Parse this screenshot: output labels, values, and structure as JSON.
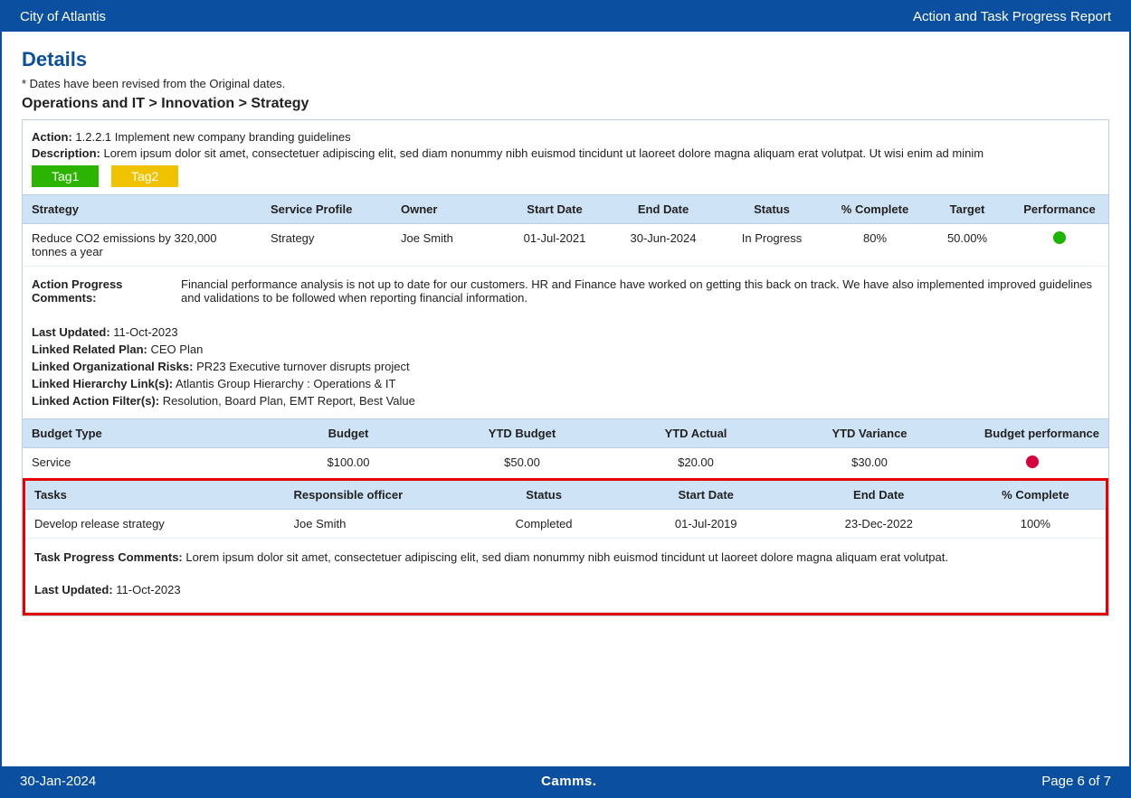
{
  "header": {
    "left": "City of Atlantis",
    "right": "Action and Task Progress Report"
  },
  "footer": {
    "date": "30-Jan-2024",
    "brand": "Camms.",
    "page": "Page 6 of 7"
  },
  "section_title": "Details",
  "date_note": "* Dates have been revised from the Original dates.",
  "breadcrumb": "Operations and IT > Innovation > Strategy",
  "action": {
    "action_label": "Action:",
    "action_value": "1.2.2.1 Implement new company branding guidelines",
    "description_label": "Description:",
    "description_value": "Lorem ipsum dolor sit amet, consectetuer adipiscing elit, sed diam nonummy nibh euismod tincidunt ut laoreet dolore magna aliquam erat volutpat. Ut wisi enim ad minim",
    "tags": [
      "Tag1",
      "Tag2"
    ]
  },
  "strategy_table": {
    "headers": [
      "Strategy",
      "Service Profile",
      "Owner",
      "Start Date",
      "End Date",
      "Status",
      "% Complete",
      "Target",
      "Performance"
    ],
    "row": {
      "strategy": "Reduce CO2 emissions by 320,000 tonnes a year",
      "service_profile": "Strategy",
      "owner": "Joe Smith",
      "start_date": "01-Jul-2021",
      "end_date": "30-Jun-2024",
      "status": "In Progress",
      "complete": "80%",
      "target": "50.00%",
      "perf_color": "green"
    }
  },
  "meta": {
    "apc_label": "Action Progress Comments:",
    "apc_value": "Financial performance analysis is not up to date for our customers. HR and Finance have worked on getting this back on track. We have also implemented improved guidelines and validations to be followed when reporting financial information.",
    "last_updated_label": "Last Updated:",
    "last_updated_value": "11-Oct-2023",
    "related_plan_label": "Linked Related Plan:",
    "related_plan_value": "CEO Plan",
    "org_risks_label": "Linked Organizational Risks:",
    "org_risks_value": "PR23 Executive turnover disrupts project",
    "hierarchy_label": "Linked Hierarchy Link(s):",
    "hierarchy_value": "Atlantis Group Hierarchy : Operations & IT",
    "filters_label": "Linked Action Filter(s):",
    "filters_value": "Resolution, Board Plan, EMT Report, Best Value"
  },
  "budget_table": {
    "headers": [
      "Budget Type",
      "Budget",
      "YTD Budget",
      "YTD Actual",
      "YTD Variance",
      "Budget performance"
    ],
    "row": {
      "type": "Service",
      "budget": "$100.00",
      "ytd_budget": "$50.00",
      "ytd_actual": "$20.00",
      "ytd_variance": "$30.00",
      "perf_color": "red"
    }
  },
  "tasks_table": {
    "headers": [
      "Tasks",
      "Responsible officer",
      "Status",
      "Start Date",
      "End Date",
      "% Complete"
    ],
    "row": {
      "task": "Develop release strategy",
      "officer": "Joe Smith",
      "status": "Completed",
      "start_date": "01-Jul-2019",
      "end_date": "23-Dec-2022",
      "complete": "100%"
    },
    "tpc_label": "Task Progress Comments:",
    "tpc_value": "Lorem ipsum dolor sit amet, consectetuer adipiscing elit, sed diam nonummy nibh euismod tincidunt ut laoreet dolore magna aliquam erat volutpat.",
    "last_updated_label": "Last Updated:",
    "last_updated_value": "11-Oct-2023"
  }
}
